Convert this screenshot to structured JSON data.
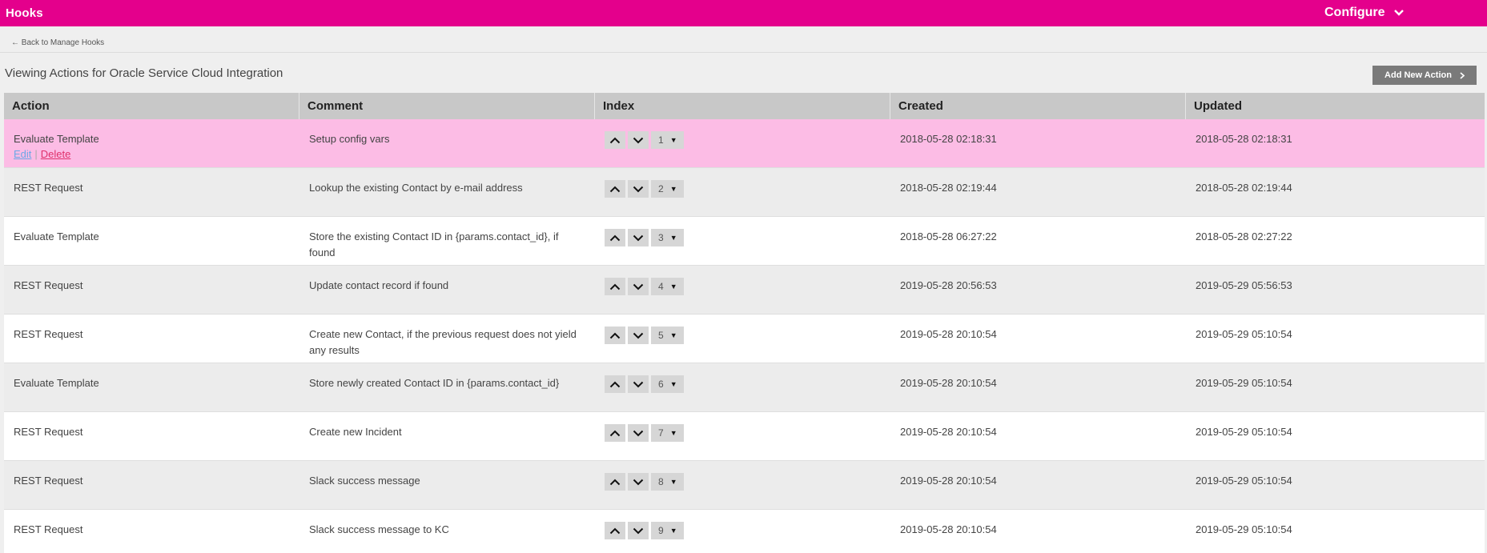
{
  "header": {
    "brand": "Hooks",
    "configure_label": "Configure"
  },
  "back_link": "← Back to Manage Hooks",
  "page_heading": "Viewing Actions for Oracle Service Cloud Integration",
  "add_button_label": "Add New Action",
  "table": {
    "columns": [
      "Action",
      "Comment",
      "Index",
      "Created",
      "Updated"
    ],
    "row_links": {
      "edit": "Edit",
      "separator": "|",
      "delete": "Delete"
    },
    "rows": [
      {
        "action": "Evaluate Template",
        "comment": "Setup config vars",
        "index": "1",
        "created": "2018-05-28 02:18:31",
        "updated": "2018-05-28 02:18:31"
      },
      {
        "action": "REST Request",
        "comment": "Lookup the existing Contact by e-mail address",
        "index": "2",
        "created": "2018-05-28 02:19:44",
        "updated": "2018-05-28 02:19:44"
      },
      {
        "action": "Evaluate Template",
        "comment": "Store the existing Contact ID in {params.contact_id}, if found",
        "index": "3",
        "created": "2018-05-28 06:27:22",
        "updated": "2018-05-28 02:27:22"
      },
      {
        "action": "REST Request",
        "comment": "Update contact record if found",
        "index": "4",
        "created": "2019-05-28 20:56:53",
        "updated": "2019-05-29 05:56:53"
      },
      {
        "action": "REST Request",
        "comment": "Create new Contact, if the previous request does not yield any results",
        "index": "5",
        "created": "2019-05-28 20:10:54",
        "updated": "2019-05-29 05:10:54"
      },
      {
        "action": "Evaluate Template",
        "comment": "Store newly created Contact ID in {params.contact_id}",
        "index": "6",
        "created": "2019-05-28 20:10:54",
        "updated": "2019-05-29 05:10:54"
      },
      {
        "action": "REST Request",
        "comment": "Create new Incident",
        "index": "7",
        "created": "2019-05-28 20:10:54",
        "updated": "2019-05-29 05:10:54"
      },
      {
        "action": "REST Request",
        "comment": "Slack success message",
        "index": "8",
        "created": "2019-05-28 20:10:54",
        "updated": "2019-05-29 05:10:54"
      },
      {
        "action": "REST Request",
        "comment": "Slack success message to KC",
        "index": "9",
        "created": "2019-05-28 20:10:54",
        "updated": "2019-05-29 05:10:54"
      }
    ]
  },
  "colors": {
    "brand": "#e4008c",
    "row_highlight": "#fcbce5",
    "button": "#7a7a7a"
  },
  "icons": {
    "configure": "chevron-down-icon",
    "add": "chevron-right-icon",
    "move_up": "chevron-up-icon",
    "move_down": "chevron-down-icon",
    "select": "triangle-down-icon"
  }
}
